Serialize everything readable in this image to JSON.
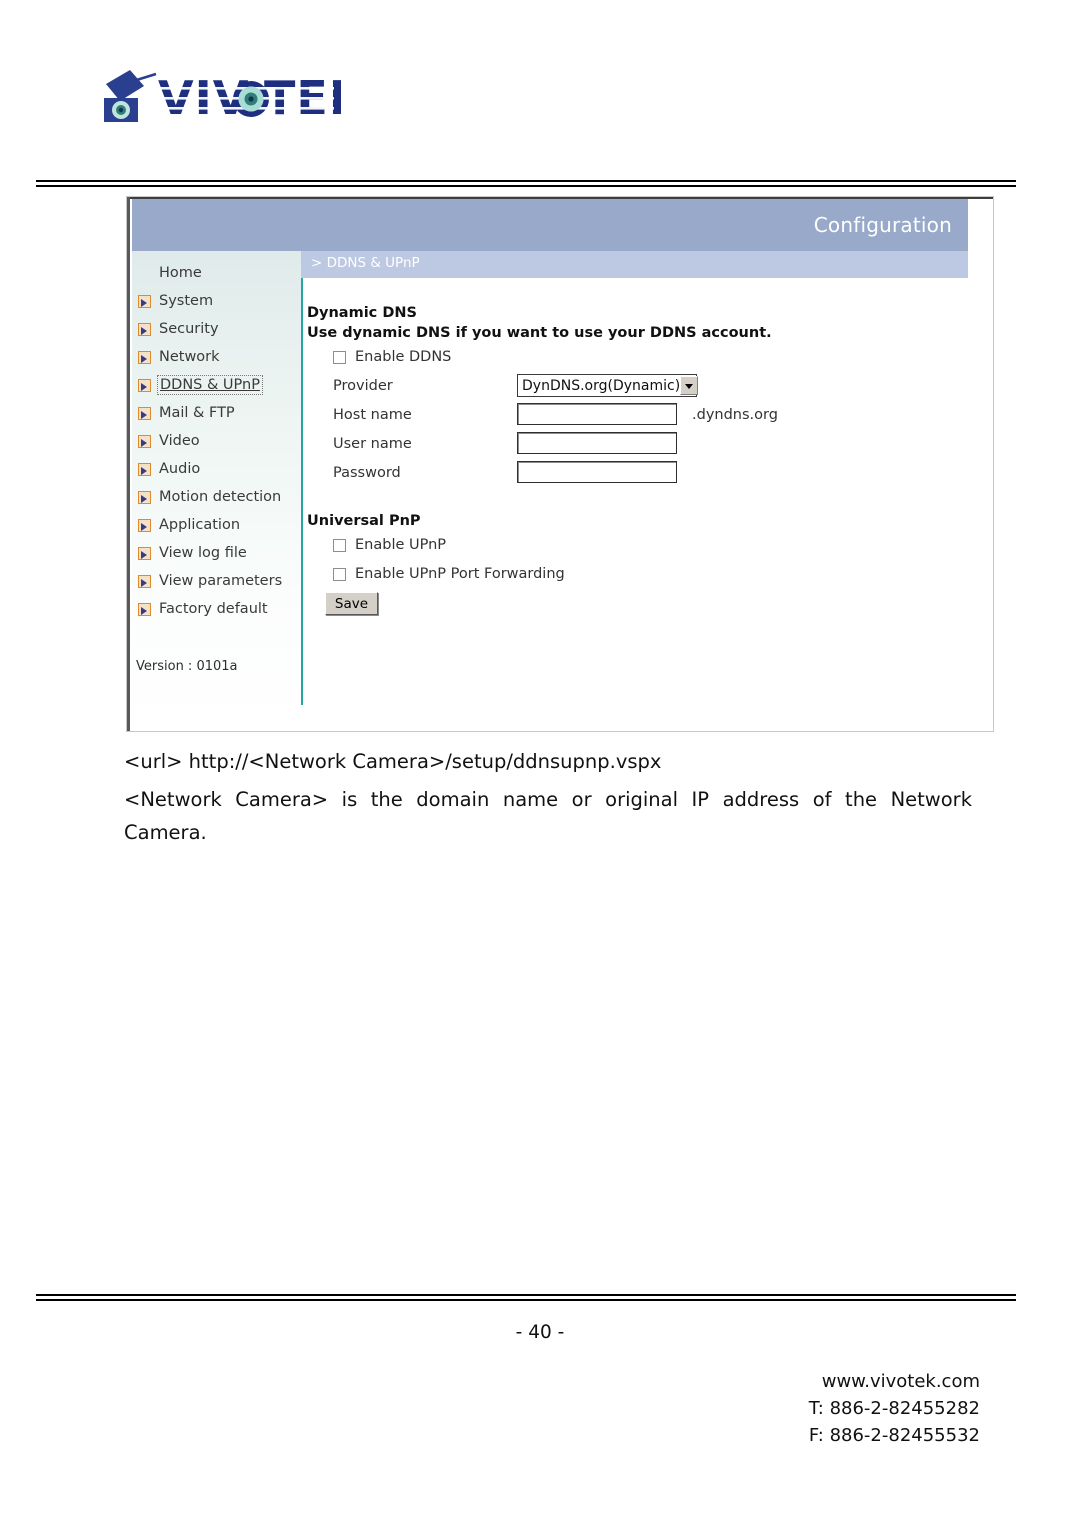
{
  "brand": {
    "logo_text": "VIVOTEK",
    "logo_alt": "vivotek-logo"
  },
  "screenshot": {
    "header": {
      "title": "Configuration"
    },
    "breadcrumb": {
      "text": "> DDNS & UPnP"
    },
    "sidebar": {
      "items": [
        {
          "label": "Home",
          "icon": "",
          "current": false
        },
        {
          "label": "System",
          "icon": "arrow-icon",
          "current": false
        },
        {
          "label": "Security",
          "icon": "arrow-icon",
          "current": false
        },
        {
          "label": "Network",
          "icon": "arrow-icon",
          "current": false
        },
        {
          "label": "DDNS & UPnP",
          "icon": "arrow-icon",
          "current": true
        },
        {
          "label": "Mail & FTP",
          "icon": "arrow-icon",
          "current": false
        },
        {
          "label": "Video",
          "icon": "arrow-icon",
          "current": false
        },
        {
          "label": "Audio",
          "icon": "arrow-icon",
          "current": false
        },
        {
          "label": "Motion detection",
          "icon": "arrow-icon",
          "current": false
        },
        {
          "label": "Application",
          "icon": "arrow-icon",
          "current": false
        },
        {
          "label": "View log file",
          "icon": "arrow-icon",
          "current": false
        },
        {
          "label": "View parameters",
          "icon": "arrow-icon",
          "current": false
        },
        {
          "label": "Factory default",
          "icon": "arrow-icon",
          "current": false
        }
      ],
      "version": "Version : 0101a"
    },
    "content": {
      "dynamic_dns": {
        "heading": "Dynamic DNS",
        "subheading": "Use dynamic DNS if you want to use your DDNS account.",
        "enable_ddns_label": "Enable DDNS",
        "enable_ddns_checked": false,
        "provider_label": "Provider",
        "provider_value": "DynDNS.org(Dynamic)",
        "host_name_label": "Host name",
        "host_name_value": "",
        "host_name_suffix": ".dyndns.org",
        "user_name_label": "User name",
        "user_name_value": "",
        "password_label": "Password",
        "password_value": ""
      },
      "universal_pnp": {
        "heading": "Universal PnP",
        "enable_upnp_label": "Enable UPnP",
        "enable_upnp_checked": false,
        "enable_port_fwd_label": "Enable UPnP Port Forwarding",
        "enable_port_fwd_checked": false
      },
      "save_label": "Save"
    },
    "colors": {
      "header_blue": "#98a9c9",
      "breadcrumb_blue": "#bdc9e2",
      "divider_teal": "#23a7a0",
      "icon_orange": "#e08a2e"
    }
  },
  "document": {
    "url_line": "<url> http://<Network Camera>/setup/ddnsupnp.vspx",
    "description": "<Network Camera> is the domain name or original IP address of the Network Camera.",
    "page_number": "- 40 -",
    "footer": {
      "website": "www.vivotek.com",
      "phone": "T: 886-2-82455282",
      "fax": "F: 886-2-82455532"
    }
  }
}
